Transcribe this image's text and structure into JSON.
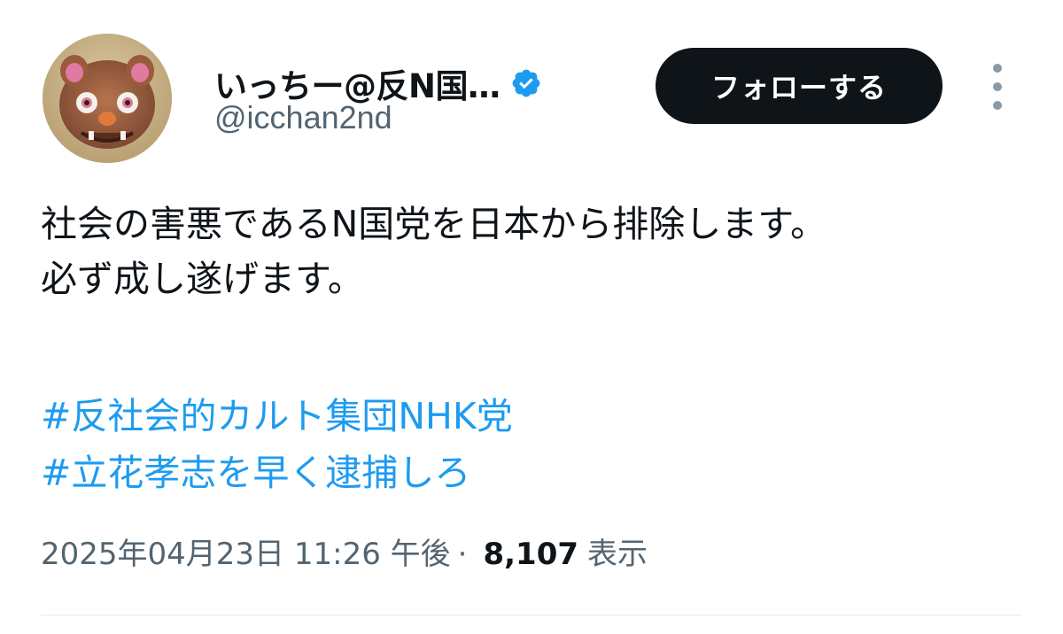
{
  "user": {
    "display_name": "いっちー@反N国…",
    "handle": "@icchan2nd",
    "verified_icon": "verified-badge-icon",
    "avatar_icon": "shisa-avatar"
  },
  "actions": {
    "follow_label": "フォローする",
    "more_icon": "more-vertical-icon"
  },
  "tweet": {
    "lines": [
      "社会の害悪であるN国党を日本から排除します。",
      "必ず成し遂げます。"
    ],
    "hashtags": [
      "#反社会的カルト集団NHK党",
      "#立花孝志を早く逮捕しろ"
    ]
  },
  "meta": {
    "timestamp": "2025年04月23日 11:26 午後",
    "separator": "·",
    "views_count": "8,107",
    "views_label": "表示"
  },
  "colors": {
    "link": "#1d9bf0",
    "text": "#0f1419",
    "secondary": "#536471",
    "button_bg": "#0f1419"
  }
}
